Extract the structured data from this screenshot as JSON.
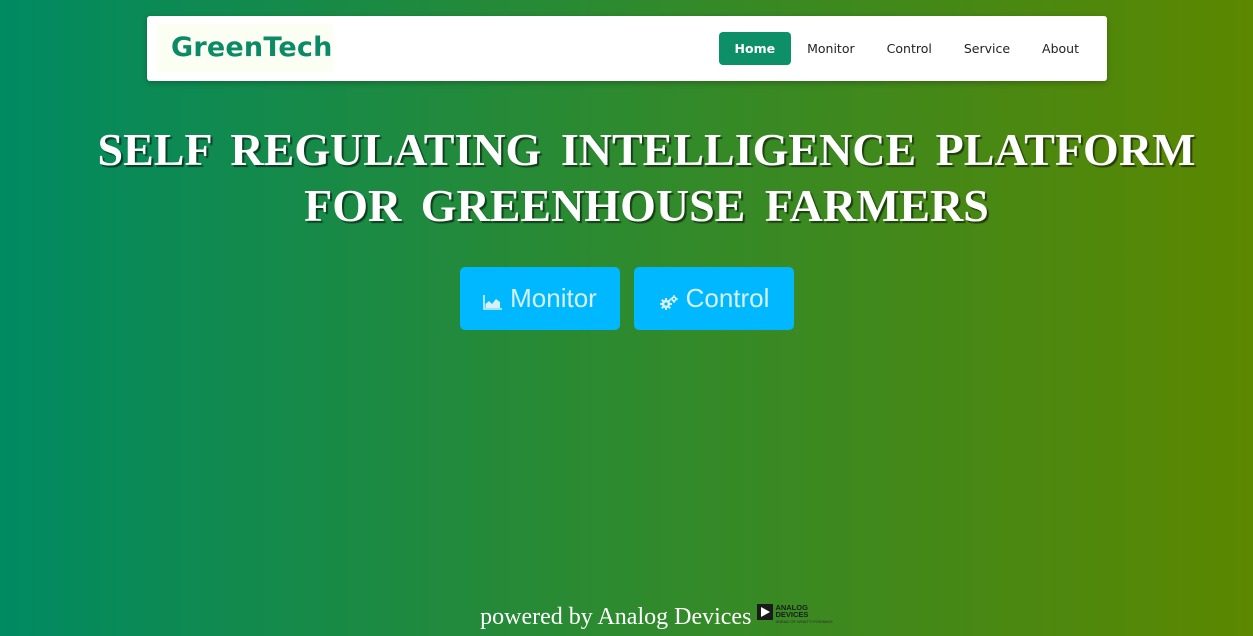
{
  "nav": {
    "brand": "GreenTech",
    "links": [
      "Home",
      "Monitor",
      "Control",
      "Service",
      "About"
    ]
  },
  "hero": {
    "title_line1": "SELF REGULATING INTELLIGENCE PLATFORM",
    "title_line2": "FOR GREENHOUSE FARMERS"
  },
  "actions": {
    "monitor": {
      "label": "Monitor",
      "icon": "area-chart-icon"
    },
    "control": {
      "label": "Control",
      "icon": "gears-icon"
    }
  },
  "footer": {
    "powered_by": "powered by Analog Devices",
    "logo_name_line1": "ANALOG",
    "logo_name_line2": "DEVICES",
    "logo_tagline": "AHEAD OF WHAT'S POSSIBLE"
  },
  "colors": {
    "gradient_start": "#008a62",
    "gradient_end": "#5c8700",
    "brand": "#0c8a66",
    "nav_active": "#0d9068",
    "button": "#00b8ff"
  }
}
